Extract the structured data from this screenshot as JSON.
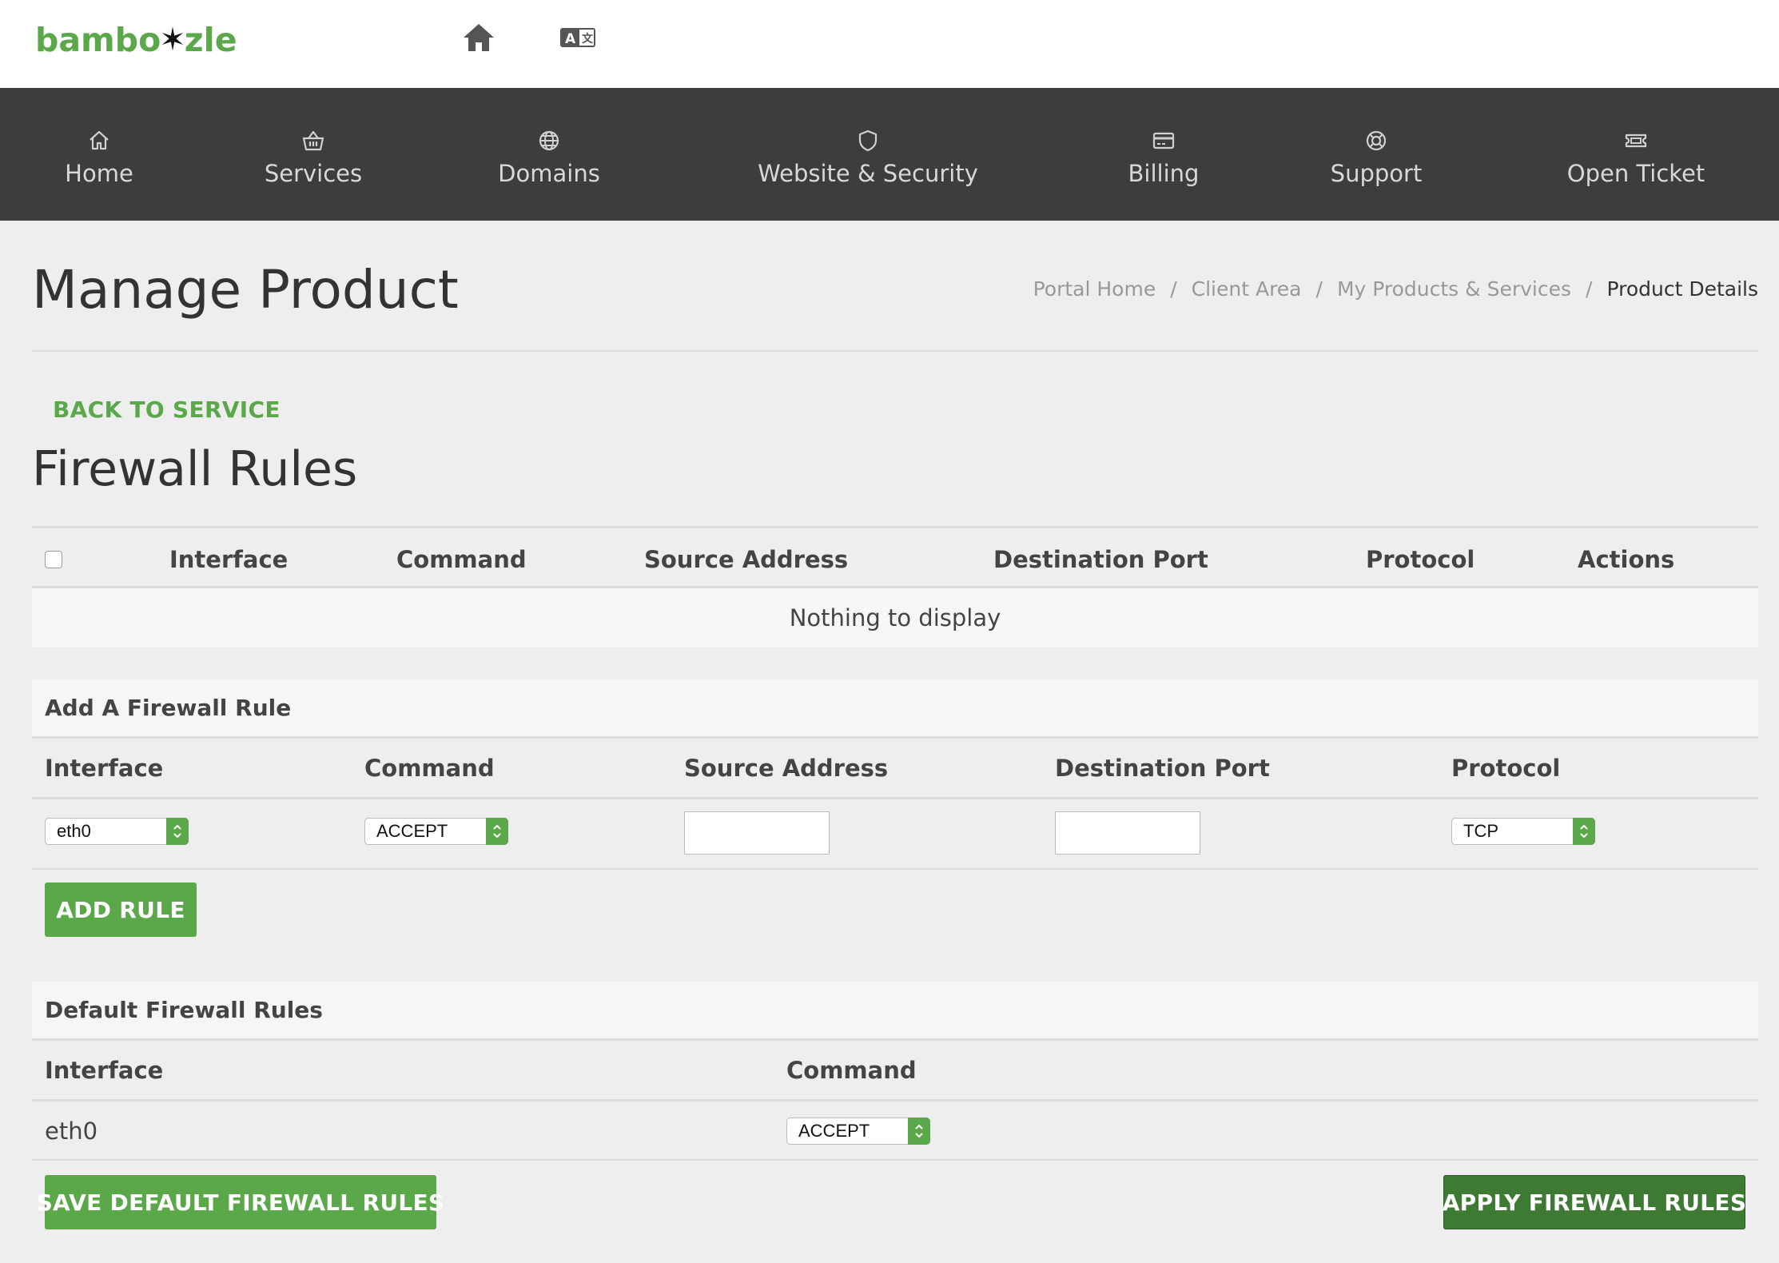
{
  "brand": {
    "logo_left": "bambo",
    "logo_star": "✶",
    "logo_right": "zle",
    "accent": "#5aa84a",
    "nav_bg": "#3d3d3d"
  },
  "topbar": {
    "icons": [
      "home-icon",
      "translate-icon"
    ]
  },
  "nav": {
    "items": [
      {
        "label": "Home",
        "icon": "home-outline-icon"
      },
      {
        "label": "Services",
        "icon": "basket-icon"
      },
      {
        "label": "Domains",
        "icon": "globe-icon"
      },
      {
        "label": "Website & Security",
        "icon": "shield-icon"
      },
      {
        "label": "Billing",
        "icon": "credit-card-icon"
      },
      {
        "label": "Support",
        "icon": "lifebuoy-icon"
      },
      {
        "label": "Open Ticket",
        "icon": "ticket-icon"
      }
    ]
  },
  "header": {
    "title": "Manage Product",
    "breadcrumb": [
      "Portal Home",
      "Client Area",
      "My Products & Services",
      "Product Details"
    ],
    "separator": "/"
  },
  "back_link": "BACK TO SERVICE",
  "section_title": "Firewall Rules",
  "rules_table": {
    "columns": [
      "Interface",
      "Command",
      "Source Address",
      "Destination Port",
      "Protocol",
      "Actions"
    ],
    "empty_message": "Nothing to display"
  },
  "add_rule_panel": {
    "title": "Add A Firewall Rule",
    "labels": [
      "Interface",
      "Command",
      "Source Address",
      "Destination Port",
      "Protocol"
    ],
    "interface_value": "eth0",
    "command_value": "ACCEPT",
    "source_address_value": "",
    "destination_port_value": "",
    "protocol_value": "TCP",
    "add_button": "ADD RULE"
  },
  "default_panel": {
    "title": "Default Firewall Rules",
    "labels": [
      "Interface",
      "Command"
    ],
    "row": {
      "interface": "eth0",
      "command": "ACCEPT"
    },
    "save_button": "SAVE DEFAULT FIREWALL RULES",
    "apply_button": "APPLY FIREWALL RULES"
  }
}
